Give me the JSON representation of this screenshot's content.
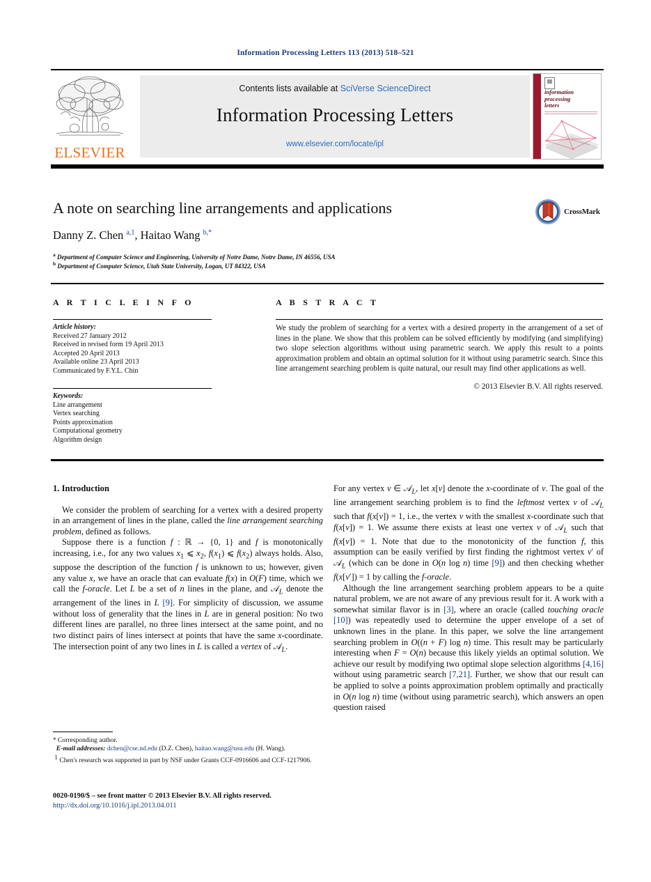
{
  "running_head": "Information Processing Letters 113 (2013) 518–521",
  "masthead": {
    "contents_prefix": "Contents lists available at ",
    "contents_link": "SciVerse ScienceDirect",
    "journal_title": "Information Processing Letters",
    "journal_url": "www.elsevier.com/locate/ipl",
    "publisher_wordmark": "ELSEVIER",
    "cover_title_lines": [
      "information",
      "processing",
      "letters"
    ]
  },
  "article": {
    "title": "A note on searching line arrangements and applications",
    "authors_html": "Danny Z. Chen <sup>a,1</sup>, Haitao Wang <sup>b,*</sup>",
    "affiliation_a": "Department of Computer Science and Engineering, University of Notre Dame, Notre Dame, IN 46556, USA",
    "affiliation_b": "Department of Computer Science, Utah State University, Logan, UT 84322, USA",
    "crossmark_label": "CrossMark"
  },
  "info": {
    "heading": "A R T I C L E   I N F O",
    "history_label": "Article history:",
    "history": [
      "Received 27 January 2012",
      "Received in revised form 19 April 2013",
      "Accepted 20 April 2013",
      "Available online 23 April 2013",
      "Communicated by F.Y.L. Chin"
    ],
    "keywords_label": "Keywords:",
    "keywords": [
      "Line arrangement",
      "Vertex searching",
      "Points approximation",
      "Computational geometry",
      "Algorithm design"
    ]
  },
  "abstract": {
    "heading": "A B S T R A C T",
    "text": "We study the problem of searching for a vertex with a desired property in the arrangement of a set of lines in the plane. We show that this problem can be solved efficiently by modifying (and simplifying) two slope selection algorithms without using parametric search. We apply this result to a points approximation problem and obtain an optimal solution for it without using parametric search. Since this line arrangement searching problem is quite natural, our result may find other applications as well.",
    "copyright": "© 2013 Elsevier B.V. All rights reserved."
  },
  "body": {
    "section_heading": "1. Introduction",
    "left_p1": "We consider the problem of searching for a vertex with a desired property in an arrangement of lines in the plane, called the <i>line arrangement searching problem</i>, defined as follows.",
    "left_p2": "Suppose there is a function <i>f</i> : ℝ → {0, 1} and <i>f</i> is monotonically increasing, i.e., for any two values <i>x</i><sub>1</sub> ⩽ <i>x</i><sub>2</sub>, <i>f</i>(<i>x</i><sub>1</sub>) ⩽ <i>f</i>(<i>x</i><sub>2</sub>) always holds. Also, suppose the description of the function <i>f</i> is unknown to us; however, given any value <i>x</i>, we have an oracle that can evaluate <i>f</i>(<i>x</i>) in <i>O</i>(<i>F</i>) time, which we call the <i>f</i>-<i>oracle</i>. Let <i>L</i> be a set of <i>n</i> lines in the plane, and 𝒜<sub><i>L</i></sub> denote the arrangement of the lines in <i>L</i> <span class=\"ref\">[9]</span>. For simplicity of discussion, we assume without loss of generality that the lines in <i>L</i> are in general position: No two different lines are parallel, no three lines intersect at the same point, and no two distinct pairs of lines intersect at points that have the same <i>x</i>-coordinate. The intersection point of any two lines in <i>L</i> is called a <i>vertex</i> of 𝒜<sub><i>L</i></sub>.",
    "right_p1": "For any vertex <i>v</i> ∈ 𝒜<sub><i>L</i></sub>, let <i>x</i>[<i>v</i>] denote the <i>x</i>-coordinate of <i>v</i>. The goal of the line arrangement searching problem is to find the <i>leftmost</i> vertex <i>v</i> of 𝒜<sub><i>L</i></sub> such that <i>f</i>(<i>x</i>[<i>v</i>]) = 1, i.e., the vertex <i>v</i> with the smallest <i>x</i>-coordinate such that <i>f</i>(<i>x</i>[<i>v</i>]) = 1. We assume there exists at least one vertex <i>v</i> of 𝒜<sub><i>L</i></sub> such that <i>f</i>(<i>x</i>[<i>v</i>]) = 1. Note that due to the monotonicity of the function <i>f</i>, this assumption can be easily verified by first finding the rightmost vertex <i>v</i>′ of 𝒜<sub><i>L</i></sub> (which can be done in <i>O</i>(<i>n</i> log <i>n</i>) time <span class=\"ref\">[9]</span>) and then checking whether <i>f</i>(<i>x</i>[<i>v</i>′]) = 1 by calling the <i>f</i>-<i>oracle</i>.",
    "right_p2": "Although the line arrangement searching problem appears to be a quite natural problem, we are not aware of any previous result for it. A work with a somewhat similar flavor is in <span class=\"ref\">[3]</span>, where an oracle (called <i>touching oracle</i> <span class=\"ref\">[10]</span>) was repeatedly used to determine the upper envelope of a set of unknown lines in the plane. In this paper, we solve the line arrangement searching problem in <i>O</i>((<i>n</i> + <i>F</i>) log <i>n</i>) time. This result may be particularly interesting when <i>F</i> = <i>O</i>(<i>n</i>) because this likely yields an optimal solution. We achieve our result by modifying two optimal slope selection algorithms <span class=\"ref\">[4,16]</span> without using parametric search <span class=\"ref\">[7,21]</span>. Further, we show that our result can be applied to solve a points approximation problem optimally and practically in <i>O</i>(<i>n</i> log <i>n</i>) time (without using parametric search), which answers an open question raised"
  },
  "footnotes": {
    "corresponding": "Corresponding author.",
    "email_label": "E-mail addresses:",
    "email_1": "dchen@cse.nd.edu",
    "email_1_who": "(D.Z. Chen),",
    "email_2": "haitao.wang@usu.edu",
    "email_2_who": "(H. Wang).",
    "funding": "Chen's research was supported in part by NSF under Grants CCF-0916606 and CCF-1217906.",
    "imprint": "0020-0190/$ – see front matter © 2013 Elsevier B.V. All rights reserved.",
    "doi": "http://dx.doi.org/10.1016/j.ipl.2013.04.011"
  }
}
